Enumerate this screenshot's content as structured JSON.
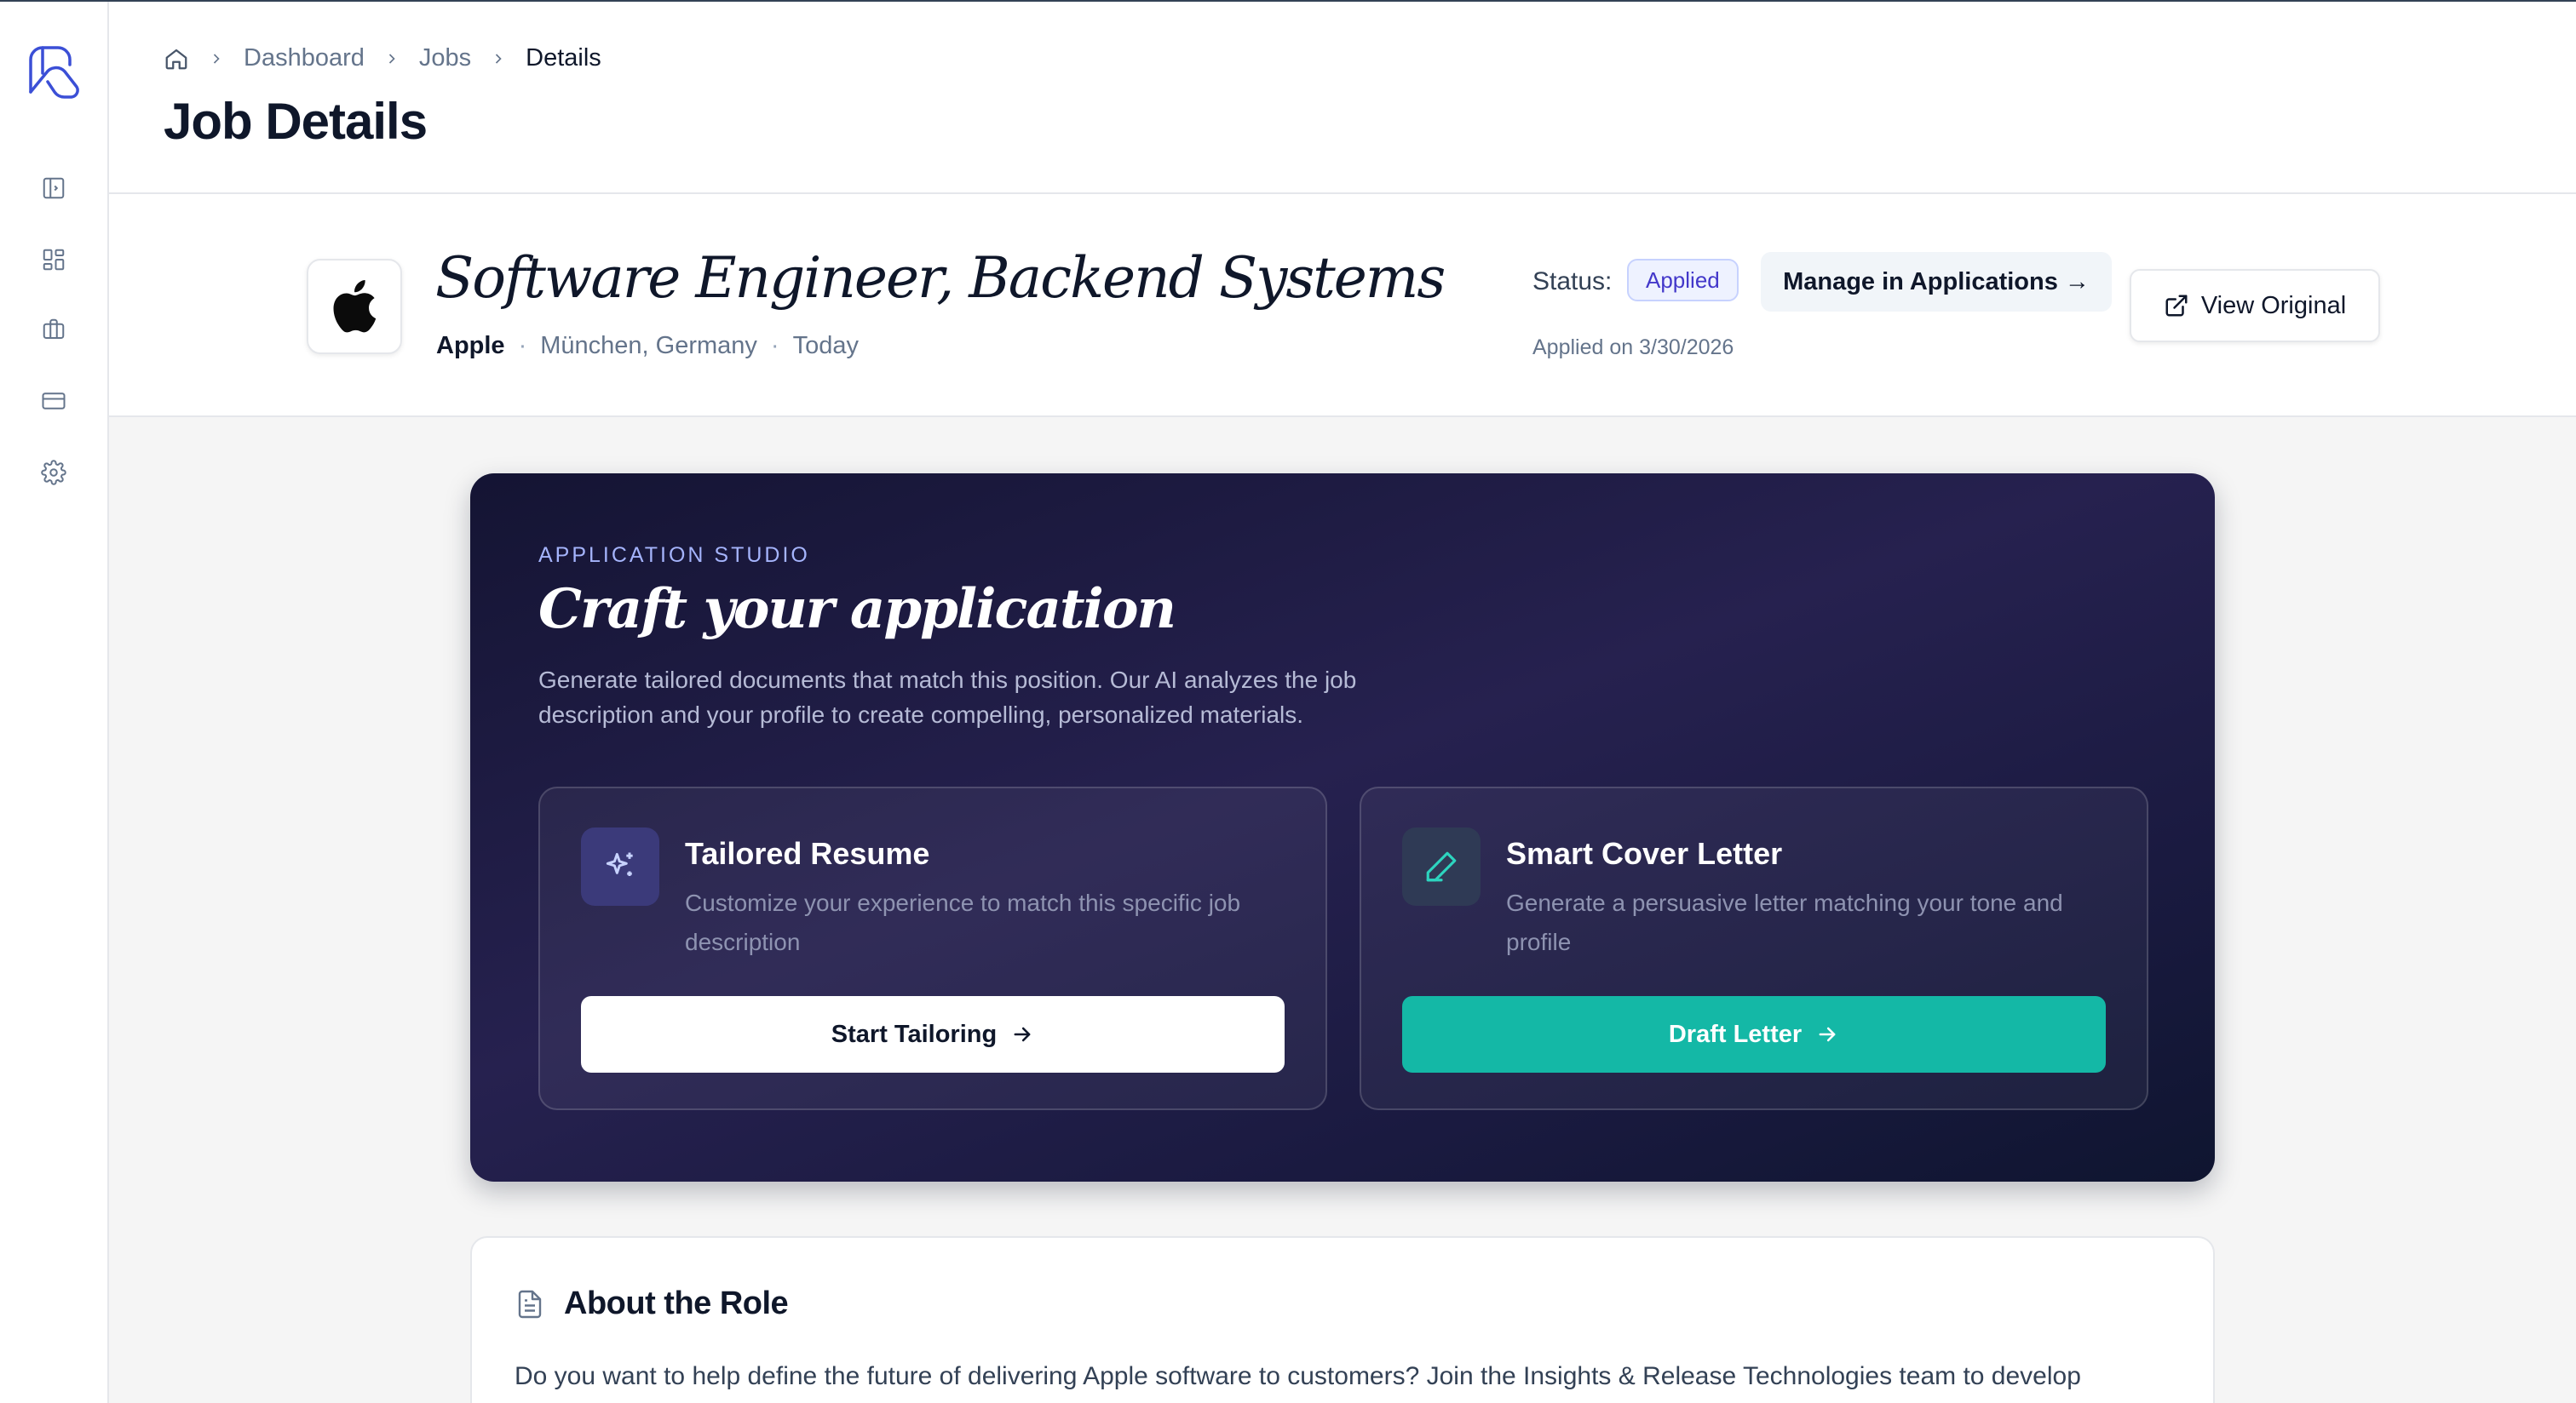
{
  "breadcrumb": {
    "home_icon": "home-icon",
    "items": [
      "Dashboard",
      "Jobs"
    ],
    "current": "Details"
  },
  "page": {
    "title": "Job Details"
  },
  "sidebar": {
    "icons": [
      "logo",
      "sidebar-toggle-icon",
      "dashboard-grid-icon",
      "briefcase-icon",
      "credit-card-icon",
      "gear-icon"
    ]
  },
  "job": {
    "title": "Software Engineer, Backend Systems",
    "company": "Apple",
    "location": "München, Germany",
    "posted": "Today",
    "status_label": "Status:",
    "status": "Applied",
    "manage_label": "Manage in Applications →",
    "applied_on": "Applied on 3/30/2026",
    "view_original_label": "View Original"
  },
  "studio": {
    "eyebrow": "APPLICATION STUDIO",
    "title": "Craft your application",
    "description": "Generate tailored documents that match this position. Our AI analyzes the job description and your profile to create compelling, personalized materials.",
    "cards": [
      {
        "title": "Tailored Resume",
        "description": "Customize your experience to match this specific job description",
        "button": "Start Tailoring",
        "icon": "sparkles-icon"
      },
      {
        "title": "Smart Cover Letter",
        "description": "Generate a persuasive letter matching your tone and profile",
        "button": "Draft Letter",
        "icon": "pen-icon"
      }
    ]
  },
  "about": {
    "title": "About the Role",
    "text": "Do you want to help define the future of delivering Apple software to customers? Join the Insights & Release Technologies team to develop"
  },
  "colors": {
    "accent_teal": "#14b8a6",
    "badge_indigo": "#4338ca",
    "studio_dark": "#1e1b4b"
  }
}
